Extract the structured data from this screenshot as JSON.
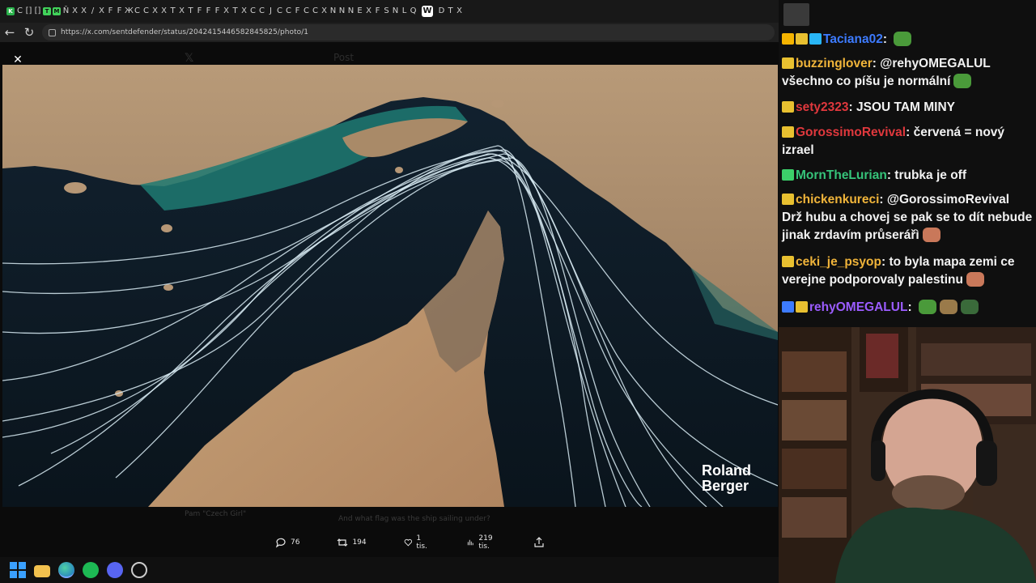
{
  "browser": {
    "url": "https://x.com/sentdefender/status/2042415446582845825/photo/1",
    "active_tab_letter": "W",
    "tab_favicons": [
      "K",
      "C",
      "[]",
      "[]",
      "T",
      "M",
      "Ň",
      "X",
      "X",
      "/",
      "X",
      "F",
      "F",
      "Ж",
      "C",
      "C",
      "X",
      "X",
      "T",
      "X",
      "T",
      "F",
      "F",
      "F",
      "X",
      "T",
      "X",
      "C",
      "C",
      "J",
      "C",
      "C",
      "F",
      "C",
      "C",
      "X",
      "N",
      "N",
      "N",
      "E",
      "X",
      "F",
      "S",
      "N",
      "L",
      "Q",
      "D",
      "T",
      "X"
    ]
  },
  "post": {
    "watermark": "Roland\nBerger",
    "bg_header": "Post",
    "replies": "76",
    "reposts": "194",
    "likes": "1 tis.",
    "views": "219 tis.",
    "behind_reply_user": "Pam \"Czech Girl\"",
    "behind_reply_text": "And what flag was the ship sailing under?"
  },
  "chat": {
    "messages": [
      {
        "user": "Taciana02",
        "color": "#3d7bff",
        "text": "",
        "badges": [
          "crown",
          "star",
          "cube"
        ],
        "emotes": [
          "pepe-emote"
        ]
      },
      {
        "user": "buzzinglover",
        "color": "#f0b43a",
        "text": "@rehyOMEGALUL všechno co píšu je normální",
        "badges": [
          "star"
        ],
        "emotes": [
          "pepe-emote"
        ]
      },
      {
        "user": "sety2323",
        "color": "#e0383d",
        "text": "JSOU TAM MINY",
        "badges": [
          "star"
        ],
        "emotes": []
      },
      {
        "user": "GorossimoRevival",
        "color": "#e0383d",
        "text": "červená = nový izrael",
        "badges": [
          "star"
        ],
        "emotes": []
      },
      {
        "user": "MornTheLurian",
        "color": "#36c47a",
        "text": "trubka je off",
        "badges": [
          "green-star"
        ],
        "emotes": []
      },
      {
        "user": "chickenkureci",
        "color": "#f0b43a",
        "text": "@GorossimoRevival Drž hubu a chovej se pak se to dít nebude jinak zrdavím průserářì",
        "badges": [
          "star"
        ],
        "emotes": [
          "face-emote"
        ]
      },
      {
        "user": "ceki_je_psyop",
        "color": "#f0b43a",
        "text": "to byla mapa zemi ce verejne podporovaly palestinu",
        "badges": [
          "star"
        ],
        "emotes": [
          "face-emote"
        ]
      },
      {
        "user": "rehyOMEGALUL",
        "color": "#9b5cff",
        "text": "",
        "badges": [
          "arrow",
          "star"
        ],
        "emotes": [
          "pepe-emote",
          "cat-emote",
          "frog-emote"
        ]
      }
    ]
  },
  "colors": {
    "ocean": "#0d1a24",
    "desert": "#c7a47c",
    "shallow": "#2a8f86",
    "route": "#d9ecf4"
  }
}
